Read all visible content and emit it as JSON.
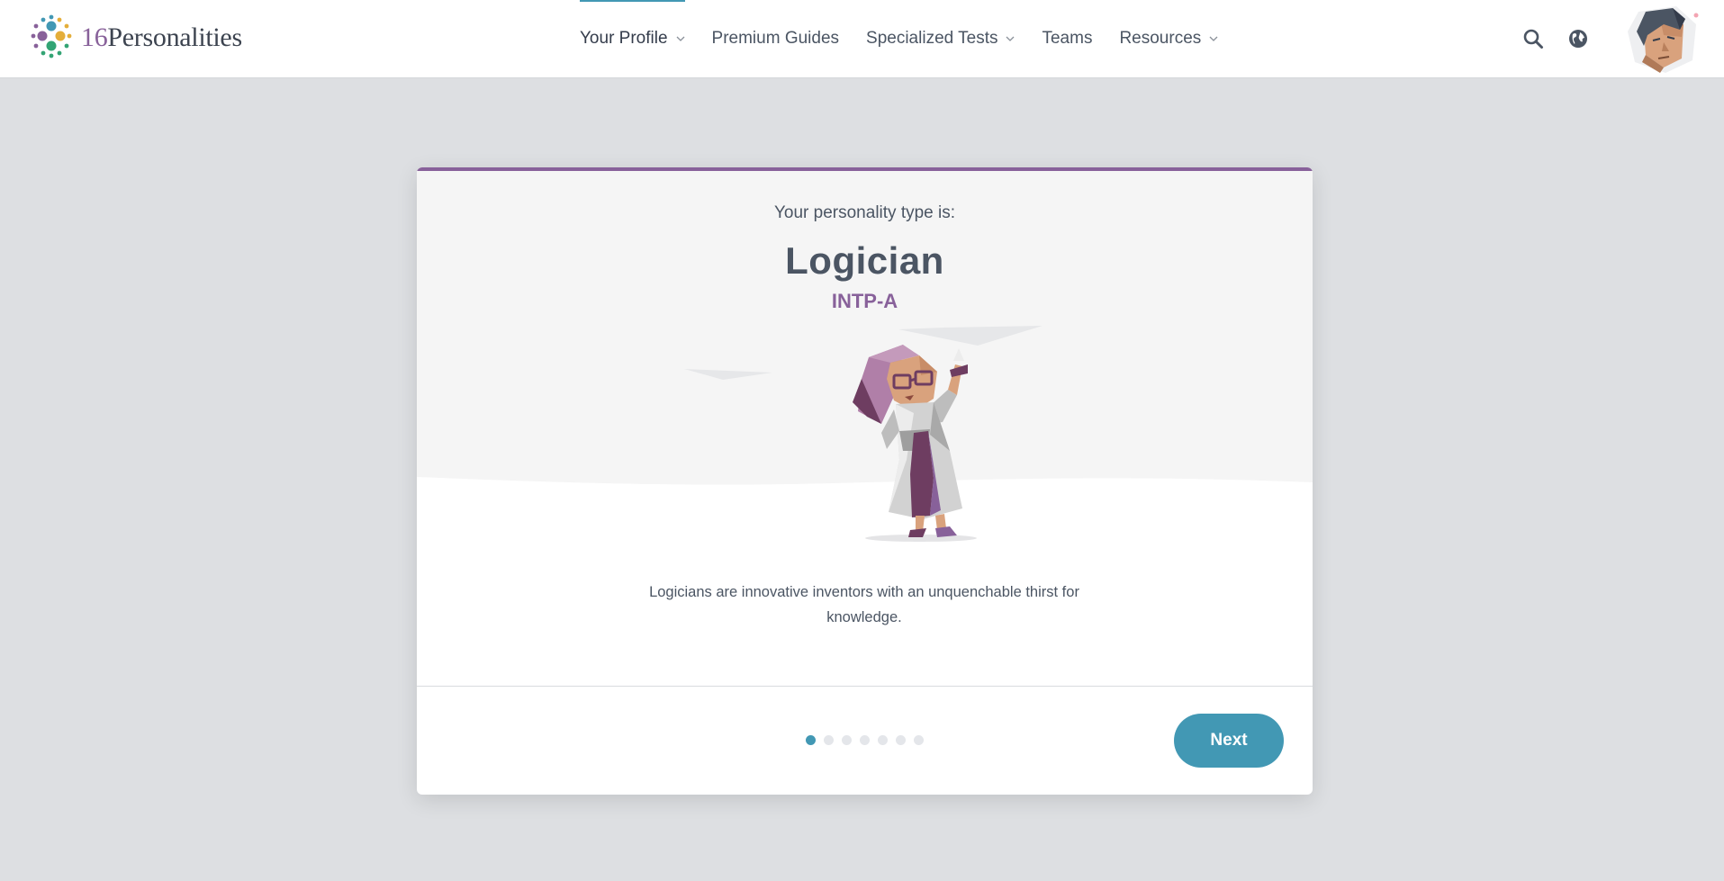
{
  "header": {
    "logo": {
      "number": "16",
      "word": "Personalities"
    },
    "nav": [
      {
        "label": "Your Profile",
        "has_dropdown": true,
        "active": true
      },
      {
        "label": "Premium Guides",
        "has_dropdown": false,
        "active": false
      },
      {
        "label": "Specialized Tests",
        "has_dropdown": true,
        "active": false
      },
      {
        "label": "Teams",
        "has_dropdown": false,
        "active": false
      },
      {
        "label": "Resources",
        "has_dropdown": true,
        "active": false
      }
    ],
    "icons": [
      "search-icon",
      "globe-icon",
      "avatar"
    ]
  },
  "card": {
    "intro": "Your personality type is:",
    "type_name": "Logician",
    "type_code": "INTP-A",
    "description": "Logicians are innovative inventors with an unquenchable thirst for knowledge.",
    "pagination": {
      "total": 7,
      "current": 1
    },
    "next_label": "Next"
  },
  "colors": {
    "accent": "#4298b4",
    "analyst_purple": "#88619a",
    "page_background": "#dddfe2",
    "text": "#4b5563"
  }
}
